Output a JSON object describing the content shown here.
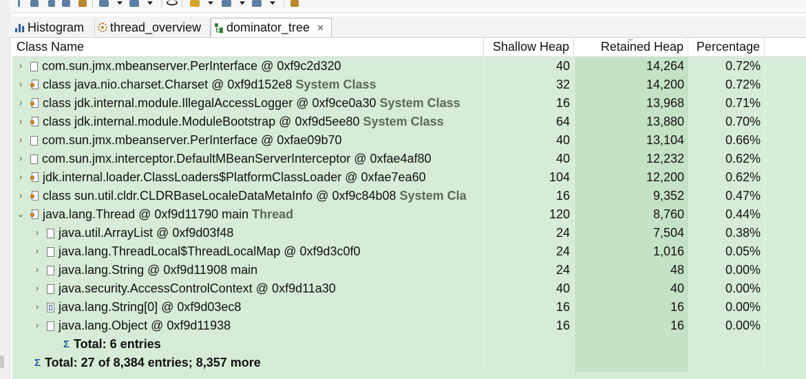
{
  "tabs": [
    {
      "label": "Histogram",
      "icon": "histogram-icon"
    },
    {
      "label": "thread_overview",
      "icon": "gear-icon"
    },
    {
      "label": "dominator_tree",
      "icon": "tree-icon",
      "active": true,
      "close": "✕"
    }
  ],
  "columns": {
    "class_name": "Class Name",
    "shallow_heap": "Shallow Heap",
    "retained_heap": "Retained Heap",
    "percentage": "Percentage"
  },
  "rows": [
    {
      "indent": 0,
      "expander": "›",
      "icon": "object",
      "name": "com.sun.jmx.mbeanserver.PerInterface @ 0xf9c2d320",
      "tag": "",
      "shallow": "40",
      "retained": "14,264",
      "pct": "0.72%"
    },
    {
      "indent": 0,
      "expander": "›",
      "icon": "class",
      "name": "class java.nio.charset.Charset @ 0xf9d152e8",
      "tag": "System Class",
      "shallow": "32",
      "retained": "14,200",
      "pct": "0.72%"
    },
    {
      "indent": 0,
      "expander": "›",
      "icon": "class",
      "name": "class jdk.internal.module.IllegalAccessLogger @ 0xf9ce0a30",
      "tag": "System Class",
      "shallow": "16",
      "retained": "13,968",
      "pct": "0.71%"
    },
    {
      "indent": 0,
      "expander": "›",
      "icon": "class",
      "name": "class jdk.internal.module.ModuleBootstrap @ 0xf9d5ee80",
      "tag": "System Class",
      "shallow": "64",
      "retained": "13,880",
      "pct": "0.70%"
    },
    {
      "indent": 0,
      "expander": "›",
      "icon": "object",
      "name": "com.sun.jmx.mbeanserver.PerInterface @ 0xfae09b70",
      "tag": "",
      "shallow": "40",
      "retained": "13,104",
      "pct": "0.66%"
    },
    {
      "indent": 0,
      "expander": "›",
      "icon": "object",
      "name": "com.sun.jmx.interceptor.DefaultMBeanServerInterceptor @ 0xfae4af80",
      "tag": "",
      "shallow": "40",
      "retained": "12,232",
      "pct": "0.62%"
    },
    {
      "indent": 0,
      "expander": "›",
      "icon": "loader",
      "name": "jdk.internal.loader.ClassLoaders$PlatformClassLoader @ 0xfae7ea60",
      "tag": "",
      "shallow": "104",
      "retained": "12,200",
      "pct": "0.62%"
    },
    {
      "indent": 0,
      "expander": "›",
      "icon": "class",
      "name": "class sun.util.cldr.CLDRBaseLocaleDataMetaInfo @ 0xf9c84b08",
      "tag": "System Cla",
      "shallow": "16",
      "retained": "9,352",
      "pct": "0.47%"
    },
    {
      "indent": 0,
      "expander": "⌄",
      "icon": "class",
      "name": "java.lang.Thread @ 0xf9d11790  main",
      "tag": "Thread",
      "shallow": "120",
      "retained": "8,760",
      "pct": "0.44%"
    },
    {
      "indent": 1,
      "expander": "›",
      "icon": "object",
      "name": "java.util.ArrayList @ 0xf9d03f48",
      "tag": "",
      "shallow": "24",
      "retained": "7,504",
      "pct": "0.38%"
    },
    {
      "indent": 1,
      "expander": "›",
      "icon": "object",
      "name": "java.lang.ThreadLocal$ThreadLocalMap @ 0xf9d3c0f0",
      "tag": "",
      "shallow": "24",
      "retained": "1,016",
      "pct": "0.05%"
    },
    {
      "indent": 1,
      "expander": "›",
      "icon": "object",
      "name": "java.lang.String @ 0xf9d11908  main",
      "tag": "",
      "shallow": "24",
      "retained": "48",
      "pct": "0.00%"
    },
    {
      "indent": 1,
      "expander": "›",
      "icon": "object",
      "name": "java.security.AccessControlContext @ 0xf9d11a30",
      "tag": "",
      "shallow": "40",
      "retained": "40",
      "pct": "0.00%"
    },
    {
      "indent": 1,
      "expander": "›",
      "icon": "array",
      "name": "java.lang.String[0] @ 0xf9d03ec8",
      "tag": "",
      "shallow": "16",
      "retained": "16",
      "pct": "0.00%"
    },
    {
      "indent": 1,
      "expander": "›",
      "icon": "object",
      "name": "java.lang.Object @ 0xf9d11938",
      "tag": "",
      "shallow": "16",
      "retained": "16",
      "pct": "0.00%"
    },
    {
      "indent": 2,
      "expander": "",
      "icon": "sigma",
      "name": "Total: 6 entries",
      "tag": "",
      "shallow": "",
      "retained": "",
      "pct": "",
      "bold": true
    },
    {
      "indent": -1,
      "expander": "",
      "icon": "sigma",
      "name": "Total: 27 of 8,384 entries; 8,357 more",
      "tag": "",
      "shallow": "",
      "retained": "",
      "pct": "",
      "bold": true
    }
  ],
  "colors": {
    "row_bg": "#d6ecd6",
    "retained_col_bg": "#c6e2c6",
    "tag_text": "#5a6a5a"
  }
}
